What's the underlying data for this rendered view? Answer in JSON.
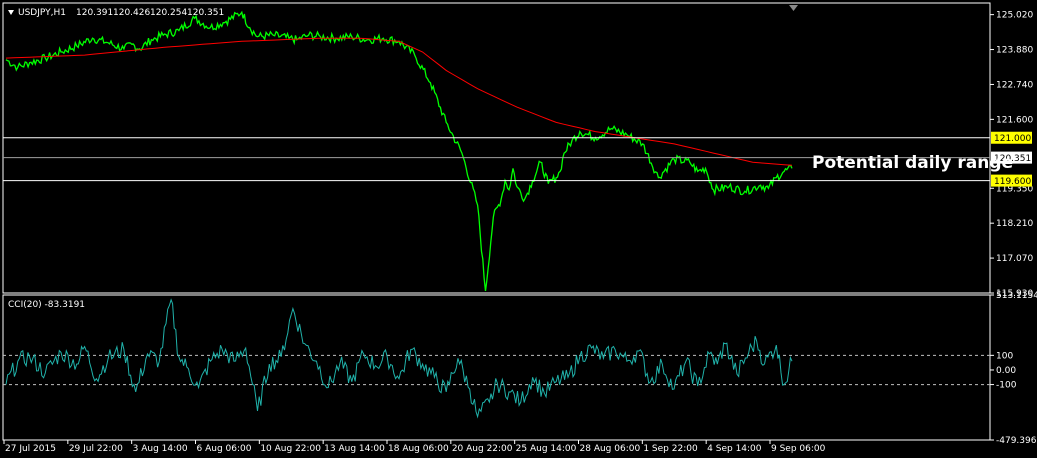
{
  "colors": {
    "background": "#000000",
    "frame": "#ffffff",
    "price_line": "#00ff00",
    "moving_average": "#ff0000",
    "level_line": "#ffffff",
    "level_label_bg": "#ffff00",
    "current_label_bg": "#ffffff",
    "cci_line": "#20b2aa",
    "cci_level_line": "#c0c0c0"
  },
  "chart_data": [
    {
      "type": "line",
      "title": "USDJPY,H1",
      "quote": {
        "open": "120.391",
        "high": "120.426",
        "low": "120.254",
        "close": "120.351"
      },
      "ylim": [
        115.93,
        125.4
      ],
      "yticks": [
        "125.020",
        "123.880",
        "122.740",
        "121.600",
        "119.350",
        "118.210",
        "117.070",
        "115.930"
      ],
      "x_range": [
        0,
        1
      ],
      "series": [
        {
          "role": "price",
          "x": [
            0,
            0.015,
            0.03,
            0.05,
            0.07,
            0.09,
            0.11,
            0.13,
            0.15,
            0.16,
            0.17,
            0.185,
            0.2,
            0.22,
            0.24,
            0.26,
            0.28,
            0.3,
            0.31,
            0.32,
            0.34,
            0.36,
            0.37,
            0.385,
            0.4,
            0.42,
            0.44,
            0.46,
            0.48,
            0.5,
            0.52,
            0.54,
            0.56,
            0.58,
            0.6,
            0.61,
            0.62,
            0.63,
            0.635,
            0.64,
            0.645,
            0.65,
            0.66,
            0.67,
            0.68,
            0.69,
            0.7,
            0.705,
            0.71,
            0.72,
            0.73,
            0.75,
            0.77,
            0.79,
            0.81,
            0.83,
            0.85,
            0.87,
            0.88,
            0.89,
            0.9,
            0.92,
            0.94,
            0.96,
            0.97,
            0.98,
            0.99,
            1
          ],
          "values": [
            123.55,
            123.3,
            123.45,
            123.6,
            123.8,
            124.0,
            124.25,
            124.1,
            123.9,
            124.05,
            123.9,
            124.2,
            124.35,
            124.5,
            124.9,
            124.6,
            124.8,
            125.1,
            124.6,
            124.3,
            124.35,
            124.25,
            124.2,
            124.35,
            124.3,
            124.25,
            124.3,
            124.2,
            124.25,
            124.15,
            123.7,
            122.8,
            121.5,
            120.5,
            118.8,
            116.0,
            118.4,
            119.0,
            119.6,
            119.3,
            120.0,
            119.4,
            119.0,
            119.6,
            120.2,
            119.5,
            119.7,
            119.9,
            120.5,
            120.9,
            121.2,
            121.0,
            121.3,
            121.1,
            120.8,
            119.7,
            120.3,
            120.2,
            119.9,
            120.0,
            119.3,
            119.4,
            119.25,
            119.45,
            119.35,
            119.7,
            119.9,
            120.0
          ]
        },
        {
          "role": "moving_average",
          "x": [
            0,
            0.1,
            0.2,
            0.3,
            0.4,
            0.45,
            0.5,
            0.53,
            0.56,
            0.6,
            0.65,
            0.7,
            0.75,
            0.8,
            0.85,
            0.9,
            0.95,
            1
          ],
          "values": [
            123.6,
            123.7,
            123.95,
            124.15,
            124.25,
            124.25,
            124.15,
            123.8,
            123.2,
            122.6,
            122.0,
            121.5,
            121.2,
            121.0,
            120.8,
            120.5,
            120.2,
            120.1
          ]
        }
      ],
      "price_levels": {
        "upper": "121.000",
        "current": "120.351",
        "lower": "119.600"
      },
      "annotation": "Potential daily range"
    },
    {
      "type": "line",
      "title": "CCI(20) -83.3191",
      "ylim": [
        -479.3968,
        513.1154
      ],
      "yticks": [
        "513.1154",
        "100",
        "0.00",
        "-100",
        "-479.3968"
      ],
      "levels": [
        100,
        -100
      ],
      "x_range": [
        0,
        1
      ],
      "series": [
        {
          "role": "cci",
          "x": [
            0,
            0.015,
            0.03,
            0.05,
            0.07,
            0.09,
            0.1,
            0.115,
            0.13,
            0.15,
            0.165,
            0.18,
            0.195,
            0.21,
            0.22,
            0.23,
            0.245,
            0.26,
            0.275,
            0.29,
            0.305,
            0.32,
            0.335,
            0.35,
            0.365,
            0.38,
            0.395,
            0.41,
            0.425,
            0.44,
            0.455,
            0.47,
            0.485,
            0.5,
            0.515,
            0.53,
            0.545,
            0.56,
            0.575,
            0.59,
            0.6,
            0.615,
            0.625,
            0.64,
            0.655,
            0.67,
            0.685,
            0.7,
            0.715,
            0.73,
            0.745,
            0.76,
            0.775,
            0.79,
            0.805,
            0.82,
            0.835,
            0.85,
            0.865,
            0.88,
            0.895,
            0.905,
            0.915,
            0.93,
            0.945,
            0.955,
            0.965,
            0.98,
            0.99,
            1
          ],
          "values": [
            -100,
            60,
            90,
            -20,
            120,
            40,
            160,
            -60,
            80,
            140,
            -150,
            110,
            60,
            480,
            90,
            20,
            -120,
            60,
            140,
            60,
            150,
            -280,
            40,
            90,
            420,
            180,
            60,
            -120,
            50,
            -80,
            110,
            30,
            90,
            -60,
            140,
            40,
            -50,
            -150,
            80,
            -130,
            -320,
            -220,
            -90,
            -150,
            -220,
            -50,
            -160,
            -80,
            -50,
            90,
            150,
            80,
            140,
            60,
            130,
            -80,
            40,
            -130,
            60,
            -110,
            110,
            40,
            180,
            -30,
            120,
            200,
            40,
            170,
            -100,
            60
          ]
        }
      ]
    }
  ],
  "x_axis_labels": [
    "27 Jul 2015",
    "29 Jul 22:00",
    "3 Aug 14:00",
    "6 Aug 06:00",
    "10 Aug 22:00",
    "13 Aug 14:00",
    "18 Aug 06:00",
    "20 Aug 22:00",
    "25 Aug 14:00",
    "28 Aug 06:00",
    "1 Sep 22:00",
    "4 Sep 14:00",
    "9 Sep 06:00"
  ]
}
